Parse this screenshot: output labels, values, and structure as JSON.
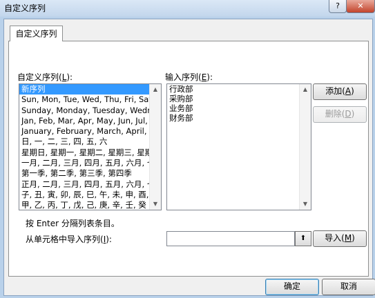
{
  "window": {
    "title": "自定义序列",
    "help_label": "?",
    "close_label": "✕"
  },
  "tab": {
    "label": "自定义序列"
  },
  "custom_lists": {
    "label_prefix": "自定义序列(",
    "label_key": "L",
    "label_suffix": "):",
    "items": [
      "新序列",
      "Sun, Mon, Tue, Wed, Thu, Fri, Sat",
      "Sunday, Monday, Tuesday, Wednesday, Thursday, Friday, Saturday",
      "Jan, Feb, Mar, Apr, May, Jun, Jul, Aug, Sep, Oct, Nov, Dec",
      "January, February, March, April, May, June",
      "日, 一, 二, 三, 四, 五, 六",
      "星期日, 星期一, 星期二, 星期三, 星期四",
      "一月, 二月, 三月, 四月, 五月, 六月, 七月",
      "第一季, 第二季, 第三季, 第四季",
      "正月, 二月, 三月, 四月, 五月, 六月, 七月",
      "子, 丑, 寅, 卯, 辰, 巳, 午, 未, 申, 酉, 戌",
      "甲, 乙, 丙, 丁, 戊, 己, 庚, 辛, 壬, 癸"
    ],
    "selected_index": 0
  },
  "entries": {
    "label_prefix": "输入序列(",
    "label_key": "E",
    "label_suffix": "):",
    "lines": [
      "行政部",
      "采购部",
      "业务部",
      "财务部"
    ]
  },
  "buttons": {
    "add_prefix": "添加(",
    "add_key": "A",
    "add_suffix": ")",
    "delete_prefix": "删除(",
    "delete_key": "D",
    "delete_suffix": ")",
    "import_prefix": "导入(",
    "import_key": "M",
    "import_suffix": ")",
    "ok": "确定",
    "cancel": "取消"
  },
  "hint": "按 Enter 分隔列表条目。",
  "import_range": {
    "label_prefix": "从单元格中导入序列(",
    "label_key": "I",
    "label_suffix": "):",
    "value": "",
    "range_icon": "⬆"
  }
}
